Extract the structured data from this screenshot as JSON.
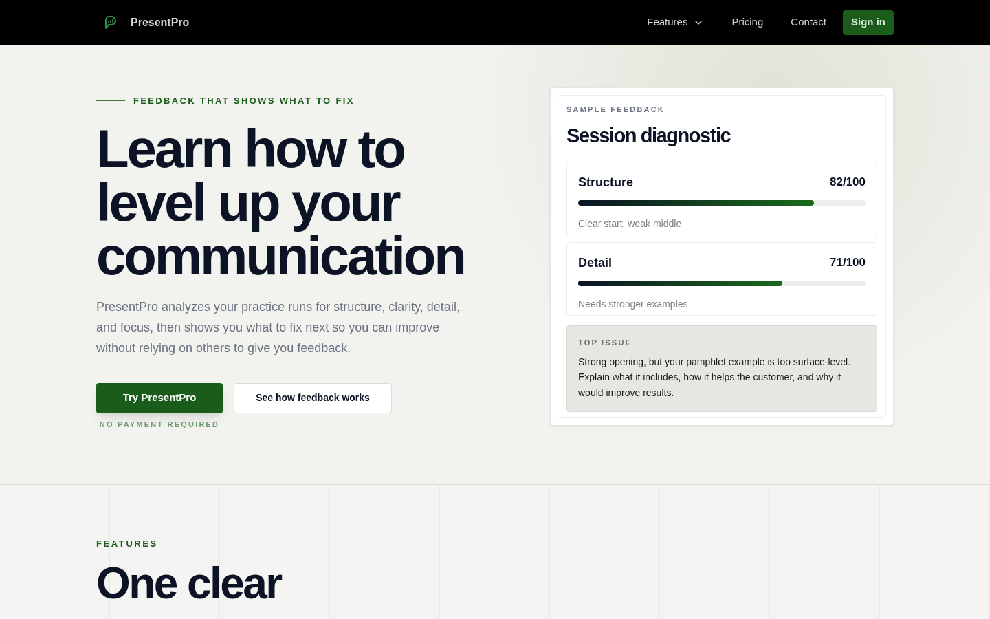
{
  "nav": {
    "brand": "PresentPro",
    "links": [
      {
        "label": "Features",
        "kind": "dropdown"
      },
      {
        "label": "Pricing",
        "kind": "link"
      },
      {
        "label": "Contact",
        "kind": "link"
      }
    ],
    "sign_in": "Sign in"
  },
  "hero": {
    "eyebrow": "FEEDBACK THAT SHOWS WHAT TO FIX",
    "heading_lines": [
      "Learn how to",
      "level up your",
      "communication"
    ],
    "description": "PresentPro analyzes your practice runs for structure, clarity, detail, and focus, then shows you what to fix next so you can improve without relying on others to give you feedback.",
    "primary_button": "Try PresentPro",
    "secondary_button": "See how feedback works",
    "note": "NO PAYMENT REQUIRED"
  },
  "card": {
    "eyebrow": "SAMPLE FEEDBACK",
    "title": "Session diagnostic",
    "metrics": [
      {
        "name": "Structure",
        "score": "82/100",
        "level": 0.82,
        "summary": "Clear start, weak middle"
      },
      {
        "name": "Detail",
        "score": "71/100",
        "level": 0.71,
        "summary": "Needs stronger examples"
      }
    ],
    "issue": {
      "label": "TOP ISSUE",
      "text": "Strong opening, but your pamphlet example is too surface-level. Explain what it includes, how it helps the customer, and why it would improve results."
    }
  },
  "features": {
    "eyebrow": "FEATURES",
    "heading": "One clear"
  }
}
